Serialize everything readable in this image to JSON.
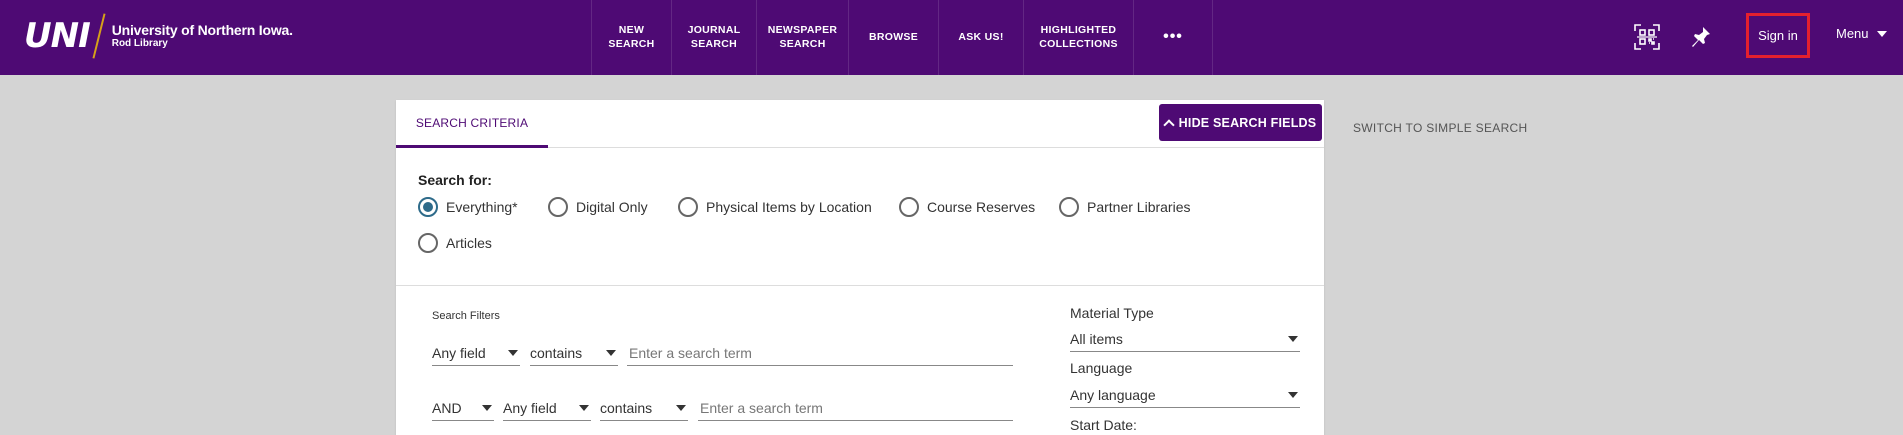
{
  "header": {
    "logo_mark": "UNI",
    "logo_line1": "University of Northern Iowa.",
    "logo_line2": "Rod Library",
    "nav": [
      {
        "label": "NEW SEARCH"
      },
      {
        "label": "JOURNAL\nSEARCH"
      },
      {
        "label": "NEWSPAPER\nSEARCH"
      },
      {
        "label": "BROWSE"
      },
      {
        "label": "ASK US!"
      },
      {
        "label": "HIGHLIGHTED\nCOLLECTIONS"
      }
    ],
    "more_label": "•••",
    "icons": [
      "qr-scan-icon",
      "pin-icon"
    ],
    "sign_in": "Sign in",
    "menu": "Menu"
  },
  "search": {
    "tab_label": "SEARCH CRITERIA",
    "hide_button": "HIDE SEARCH FIELDS",
    "switch_link": "SWITCH TO SIMPLE SEARCH",
    "search_for_label": "Search for:",
    "scopes": [
      {
        "label": "Everything*",
        "selected": true
      },
      {
        "label": "Digital Only",
        "selected": false
      },
      {
        "label": "Physical Items by Location",
        "selected": false
      },
      {
        "label": "Course Reserves",
        "selected": false
      },
      {
        "label": "Partner Libraries",
        "selected": false
      },
      {
        "label": "Articles",
        "selected": false
      }
    ],
    "filters_label": "Search Filters",
    "rows": [
      {
        "field": "Any field",
        "operator": "contains",
        "placeholder": "Enter a search term"
      },
      {
        "boolean": "AND",
        "field": "Any field",
        "operator": "contains",
        "placeholder": "Enter a search term"
      }
    ],
    "material_type_label": "Material Type",
    "material_type_value": "All items",
    "language_label": "Language",
    "language_value": "Any language",
    "start_date_label": "Start Date:"
  },
  "colors": {
    "brand_purple": "#4e0a74",
    "highlight_red": "#e4202e",
    "radio_selected": "#2e6b8a"
  }
}
